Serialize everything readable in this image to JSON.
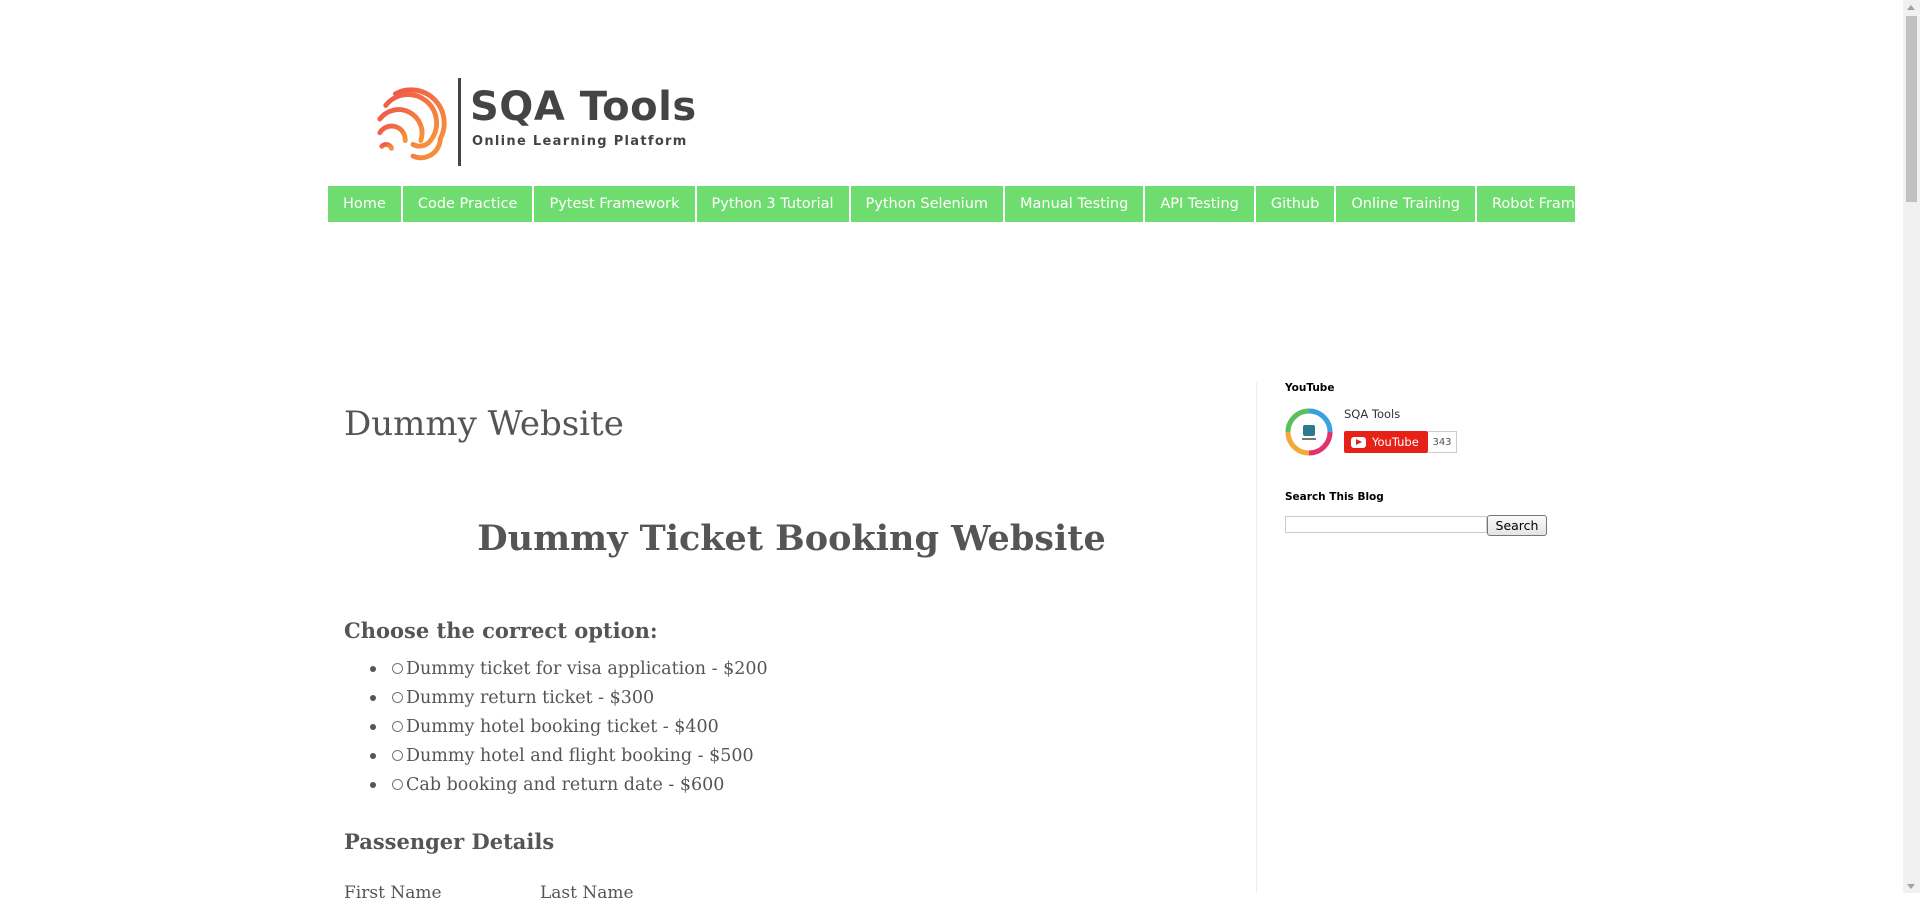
{
  "header": {
    "logo_title": "SQA Tools",
    "logo_tagline": "Online Learning Platform"
  },
  "nav": {
    "items": [
      "Home",
      "Code Practice",
      "Pytest Framework",
      "Python 3 Tutorial",
      "Python Selenium",
      "Manual Testing",
      "API Testing",
      "Github",
      "Online Training",
      "Robot Framework"
    ]
  },
  "main": {
    "page_title": "Dummy Website",
    "heading": "Dummy Ticket Booking Website",
    "choose_label": "Choose the correct option:",
    "options": [
      "Dummy ticket for visa application - $200",
      "Dummy return ticket - $300",
      "Dummy hotel booking ticket - $400",
      "Dummy hotel and flight booking - $500",
      "Cab booking and return date - $600"
    ],
    "passenger_heading": "Passenger Details",
    "first_name_label": "First Name",
    "last_name_label": "Last Name"
  },
  "sidebar": {
    "youtube": {
      "title": "YouTube",
      "channel_name": "SQA Tools",
      "button_label": "YouTube",
      "subscriber_count": "343"
    },
    "search": {
      "title": "Search This Blog",
      "button_label": "Search",
      "value": ""
    }
  },
  "icons": {
    "logo": "fingerprint-logo-icon",
    "youtube_play": "youtube-play-icon"
  },
  "colors": {
    "nav_bg": "#6fdc6f",
    "logo_orange": "#f47c3c",
    "youtube_red": "#e62117"
  }
}
